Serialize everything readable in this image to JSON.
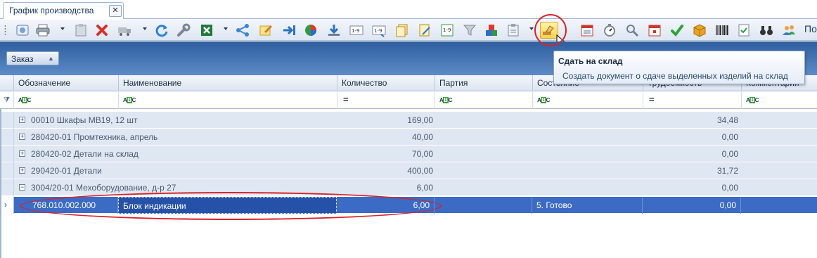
{
  "tab": {
    "title": "График производства",
    "close": "✕"
  },
  "toolbar": {
    "buttons": [
      {
        "icon": "calendar-settings-icon"
      },
      {
        "icon": "printer-icon"
      },
      {
        "icon": "clipboard-icon"
      },
      {
        "icon": "delete-icon"
      },
      {
        "icon": "truck-icon"
      },
      {
        "icon": "refresh-icon"
      },
      {
        "icon": "wrench-icon"
      },
      {
        "icon": "excel-icon"
      },
      {
        "icon": "share-icon"
      },
      {
        "icon": "note-edit-icon"
      },
      {
        "icon": "arrow-right-icon"
      },
      {
        "icon": "pie-chart-icon"
      },
      {
        "icon": "download-icon"
      },
      {
        "icon": "number-1-9-icon"
      },
      {
        "icon": "number-1-9-alt-icon"
      },
      {
        "icon": "documents-icon"
      },
      {
        "icon": "document-pen-icon"
      },
      {
        "icon": "number-list-icon"
      },
      {
        "icon": "filter-icon"
      },
      {
        "icon": "blocks-icon"
      },
      {
        "icon": "clipboard-check-icon"
      },
      {
        "icon": "hand-stamp-icon"
      },
      {
        "icon": "calendar-icon"
      },
      {
        "icon": "stopwatch-icon"
      },
      {
        "icon": "search-icon"
      },
      {
        "icon": "calendar-red-icon"
      },
      {
        "icon": "checkmark-icon"
      },
      {
        "icon": "package-icon"
      },
      {
        "icon": "barcode-icon"
      },
      {
        "icon": "document-check-icon"
      },
      {
        "icon": "binoculars-icon"
      },
      {
        "icon": "users-icon"
      }
    ],
    "overflow_text": "По"
  },
  "group_panel": {
    "chip_label": "Заказ",
    "sort_glyph": "▲"
  },
  "columns": [
    {
      "label": "Обозначение"
    },
    {
      "label": "Наименование"
    },
    {
      "label": "Количество"
    },
    {
      "label": "Партия"
    },
    {
      "label": "Состояние"
    },
    {
      "label": "Трудоемкость"
    },
    {
      "label": "Комментарий"
    }
  ],
  "filter_row": {
    "icon": "filter-icon",
    "abc_a": "A",
    "abc_b": "B",
    "abc_c": "C",
    "eq": "="
  },
  "group_rows": [
    {
      "expander": "+",
      "title": "00010 Шкафы МВ19, 12 шт",
      "quantity": "169,00",
      "labor": "34,48"
    },
    {
      "expander": "+",
      "title": "280420-01 Промтехника, апрель",
      "quantity": "40,00",
      "labor": "0,00"
    },
    {
      "expander": "+",
      "title": "280420-02 Детали на склад",
      "quantity": "70,00",
      "labor": "0,00"
    },
    {
      "expander": "+",
      "title": "290420-01 Детали",
      "quantity": "400,00",
      "labor": "31,72"
    },
    {
      "expander": "−",
      "title": "3004/20-01 Мехоборудование, д-р 27",
      "quantity": "6,00",
      "labor": "0,00"
    }
  ],
  "selected_row": {
    "indicator": "›",
    "designation": "768.010.002.000",
    "name": "Блок индикации",
    "quantity": "6,00",
    "batch": "",
    "state": "5. Готово",
    "labor": "0,00",
    "comment": ""
  },
  "tooltip": {
    "title": "Сдать на склад",
    "description": "Создать документ о сдаче выделенных изделий на склад"
  },
  "colors": {
    "selection": "#3b6bc4",
    "group_panel": "#2f5e9f",
    "annotation": "#d8232a",
    "highlight_button": "#ffd24a"
  }
}
